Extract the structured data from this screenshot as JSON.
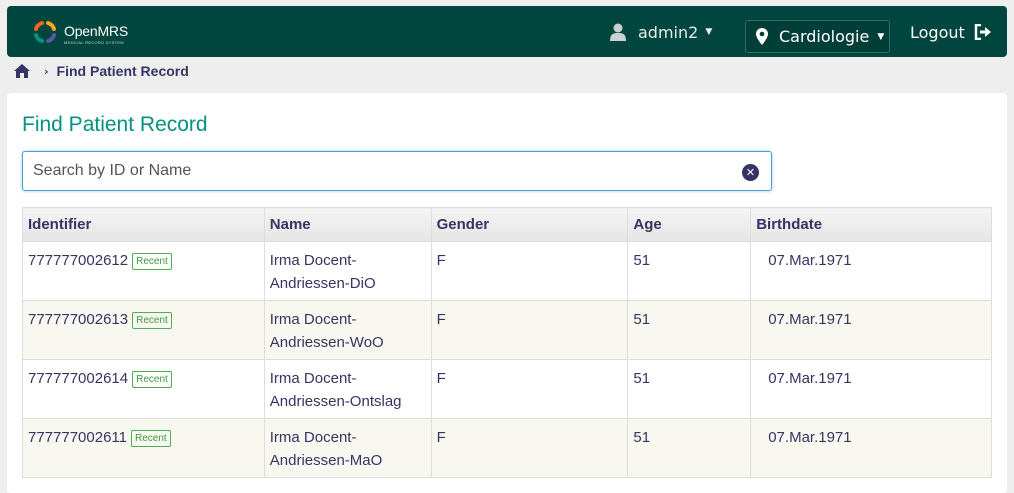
{
  "header": {
    "logo_name": "OpenMRS",
    "logo_tagline": "MEDICAL RECORD SYSTEM",
    "user": "admin2",
    "location": "Cardiologie",
    "logout": "Logout"
  },
  "breadcrumb": {
    "current": "Find Patient Record"
  },
  "page": {
    "title": "Find Patient Record",
    "search_placeholder": "Search by ID or Name",
    "search_value": ""
  },
  "table": {
    "headers": [
      "Identifier",
      "Name",
      "Gender",
      "Age",
      "Birthdate"
    ],
    "recent_label": "Recent",
    "rows": [
      {
        "identifier": "777777002612",
        "name": "Irma Docent-Andriessen-DiO",
        "gender": "F",
        "age": "51",
        "birthdate": "07.Mar.1971"
      },
      {
        "identifier": "777777002613",
        "name": "Irma Docent-Andriessen-WoO",
        "gender": "F",
        "age": "51",
        "birthdate": "07.Mar.1971"
      },
      {
        "identifier": "777777002614",
        "name": "Irma Docent-Andriessen-Ontslag",
        "gender": "F",
        "age": "51",
        "birthdate": "07.Mar.1971"
      },
      {
        "identifier": "777777002611",
        "name": "Irma Docent-Andriessen-MaO",
        "gender": "F",
        "age": "51",
        "birthdate": "07.Mar.1971"
      }
    ]
  },
  "colors": {
    "header_bg": "#00463f",
    "title": "#009384",
    "text": "#363463",
    "recent_badge": "#4caf50",
    "row_alt": "#f9f8f0"
  },
  "icons": {
    "logo": "openmrs-logo-icon",
    "user": "user-icon",
    "location": "map-pin-icon",
    "logout": "sign-out-icon",
    "home": "home-icon",
    "breadcrumb_sep": "chevron-right-icon",
    "clear": "clear-search-icon"
  }
}
